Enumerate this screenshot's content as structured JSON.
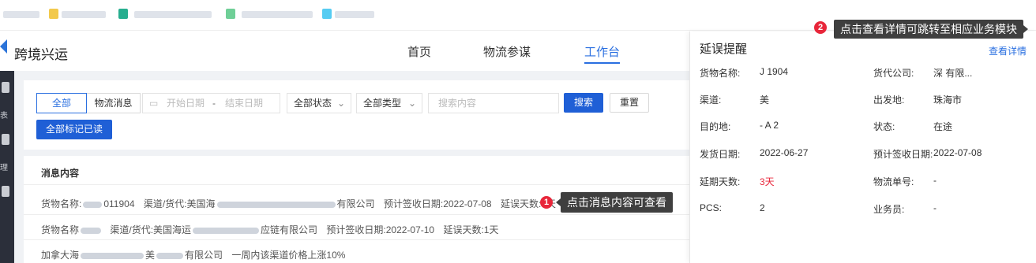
{
  "app": {
    "brand": "跨境兴运"
  },
  "nav": {
    "home": "首页",
    "logistics": "物流参谋",
    "workbench": "工作台"
  },
  "rail": {
    "label_a": "表",
    "label_b": "理"
  },
  "filters": {
    "tab_all": "全部",
    "tab_logistics_msg": "物流消息",
    "start_date": "开始日期",
    "date_sep": "-",
    "end_date": "结束日期",
    "status_select": "全部状态",
    "type_select": "全部类型",
    "search_placeholder": "搜索内容",
    "search_button": "搜索",
    "reset_button": "重置",
    "mark_all_read": "全部标记已读"
  },
  "list": {
    "header": "消息内容",
    "rows": [
      {
        "a": "货物名称:",
        "b": "011904",
        "c": "渠道/货代:美国海",
        "d": "有限公司",
        "e": "预计签收日期:2022-07-08",
        "f": "延误天数:3天"
      },
      {
        "a": "货物名称",
        "c": "渠道/货代:美国海运",
        "d": "应链有限公司",
        "e": "预计签收日期:2022-07-10",
        "f": "延误天数:1天"
      },
      {
        "a": "加拿大海",
        "c": "美",
        "d": "有限公司",
        "e": "一周内该渠道价格上涨10%"
      }
    ]
  },
  "annotations": {
    "badge1": "1",
    "callout1": "点击消息内容可查看",
    "badge2": "2",
    "callout2": "点击查看详情可跳转至相应业务模块"
  },
  "panel": {
    "title": "延误提醒",
    "link": "查看详情",
    "fields": {
      "goods_name_label": "货物名称:",
      "goods_name_value": "J  1904",
      "forwarder_label": "货代公司:",
      "forwarder_value": "深  有限...",
      "channel_label": "渠道:",
      "channel_value": "美",
      "origin_label": "出发地:",
      "origin_value": "珠海市",
      "dest_label": "目的地:",
      "dest_value": "- A 2",
      "status_label": "状态:",
      "status_value": "在途",
      "ship_date_label": "发货日期:",
      "ship_date_value": "2022-06-27",
      "eta_label": "预计签收日期:",
      "eta_value": "2022-07-08",
      "delay_label": "延期天数:",
      "delay_value": "3天",
      "tracking_label": "物流单号:",
      "tracking_value": "-",
      "pcs_label": "PCS:",
      "pcs_value": "2",
      "salesperson_label": "业务员:",
      "salesperson_value": "-"
    }
  },
  "colors": {
    "accent": "#2a6fe0",
    "danger": "#e8263a",
    "rail": "#2b2f3a",
    "tooltip": "#3f3f3f"
  }
}
